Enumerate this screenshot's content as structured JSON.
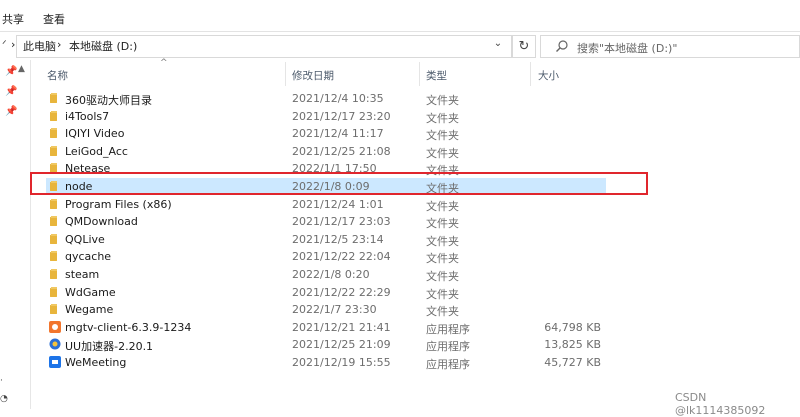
{
  "ribbon": {
    "tabs": [
      "共享",
      "查看"
    ]
  },
  "address": {
    "crumbs": [
      "此电脑",
      "本地磁盘 (D:)"
    ]
  },
  "search": {
    "placeholder": "搜索\"本地磁盘 (D:)\""
  },
  "columns": {
    "name": "名称",
    "date": "修改日期",
    "type": "类型",
    "size": "大小"
  },
  "files": [
    {
      "name": "360驱动大师目录",
      "date": "2021/12/4 10:35",
      "type": "文件夹",
      "size": "",
      "icon": "folder-icon"
    },
    {
      "name": "i4Tools7",
      "date": "2021/12/17 23:20",
      "type": "文件夹",
      "size": "",
      "icon": "folder-icon"
    },
    {
      "name": "IQIYI Video",
      "date": "2021/12/4 11:17",
      "type": "文件夹",
      "size": "",
      "icon": "folder-icon"
    },
    {
      "name": "LeiGod_Acc",
      "date": "2021/12/25 21:08",
      "type": "文件夹",
      "size": "",
      "icon": "folder-icon"
    },
    {
      "name": "Netease",
      "date": "2022/1/1 17:50",
      "type": "文件夹",
      "size": "",
      "icon": "folder-icon"
    },
    {
      "name": "node",
      "date": "2022/1/8 0:09",
      "type": "文件夹",
      "size": "",
      "icon": "folder-icon",
      "selected": true
    },
    {
      "name": "Program Files (x86)",
      "date": "2021/12/24 1:01",
      "type": "文件夹",
      "size": "",
      "icon": "folder-icon"
    },
    {
      "name": "QMDownload",
      "date": "2021/12/17 23:03",
      "type": "文件夹",
      "size": "",
      "icon": "folder-icon"
    },
    {
      "name": "QQLive",
      "date": "2021/12/5 23:14",
      "type": "文件夹",
      "size": "",
      "icon": "folder-icon"
    },
    {
      "name": "qycache",
      "date": "2021/12/22 22:04",
      "type": "文件夹",
      "size": "",
      "icon": "folder-icon"
    },
    {
      "name": "steam",
      "date": "2022/1/8 0:20",
      "type": "文件夹",
      "size": "",
      "icon": "folder-icon"
    },
    {
      "name": "WdGame",
      "date": "2021/12/22 22:29",
      "type": "文件夹",
      "size": "",
      "icon": "folder-icon"
    },
    {
      "name": "Wegame",
      "date": "2022/1/7 23:30",
      "type": "文件夹",
      "size": "",
      "icon": "folder-icon"
    },
    {
      "name": "mgtv-client-6.3.9-1234",
      "date": "2021/12/21 21:41",
      "type": "应用程序",
      "size": "64,798 KB",
      "icon": "mgtv-app-icon"
    },
    {
      "name": "UU加速器-2.20.1",
      "date": "2021/12/25 21:09",
      "type": "应用程序",
      "size": "13,825 KB",
      "icon": "uu-app-icon"
    },
    {
      "name": "WeMeeting",
      "date": "2021/12/19 15:55",
      "type": "应用程序",
      "size": "45,727 KB",
      "icon": "wemeeting-app-icon"
    }
  ],
  "watermark": "CSDN @lk1114385092",
  "colors": {
    "selection": "#cce8ff",
    "highlight_border": "#e0262d",
    "folder": "#e8b53c"
  }
}
